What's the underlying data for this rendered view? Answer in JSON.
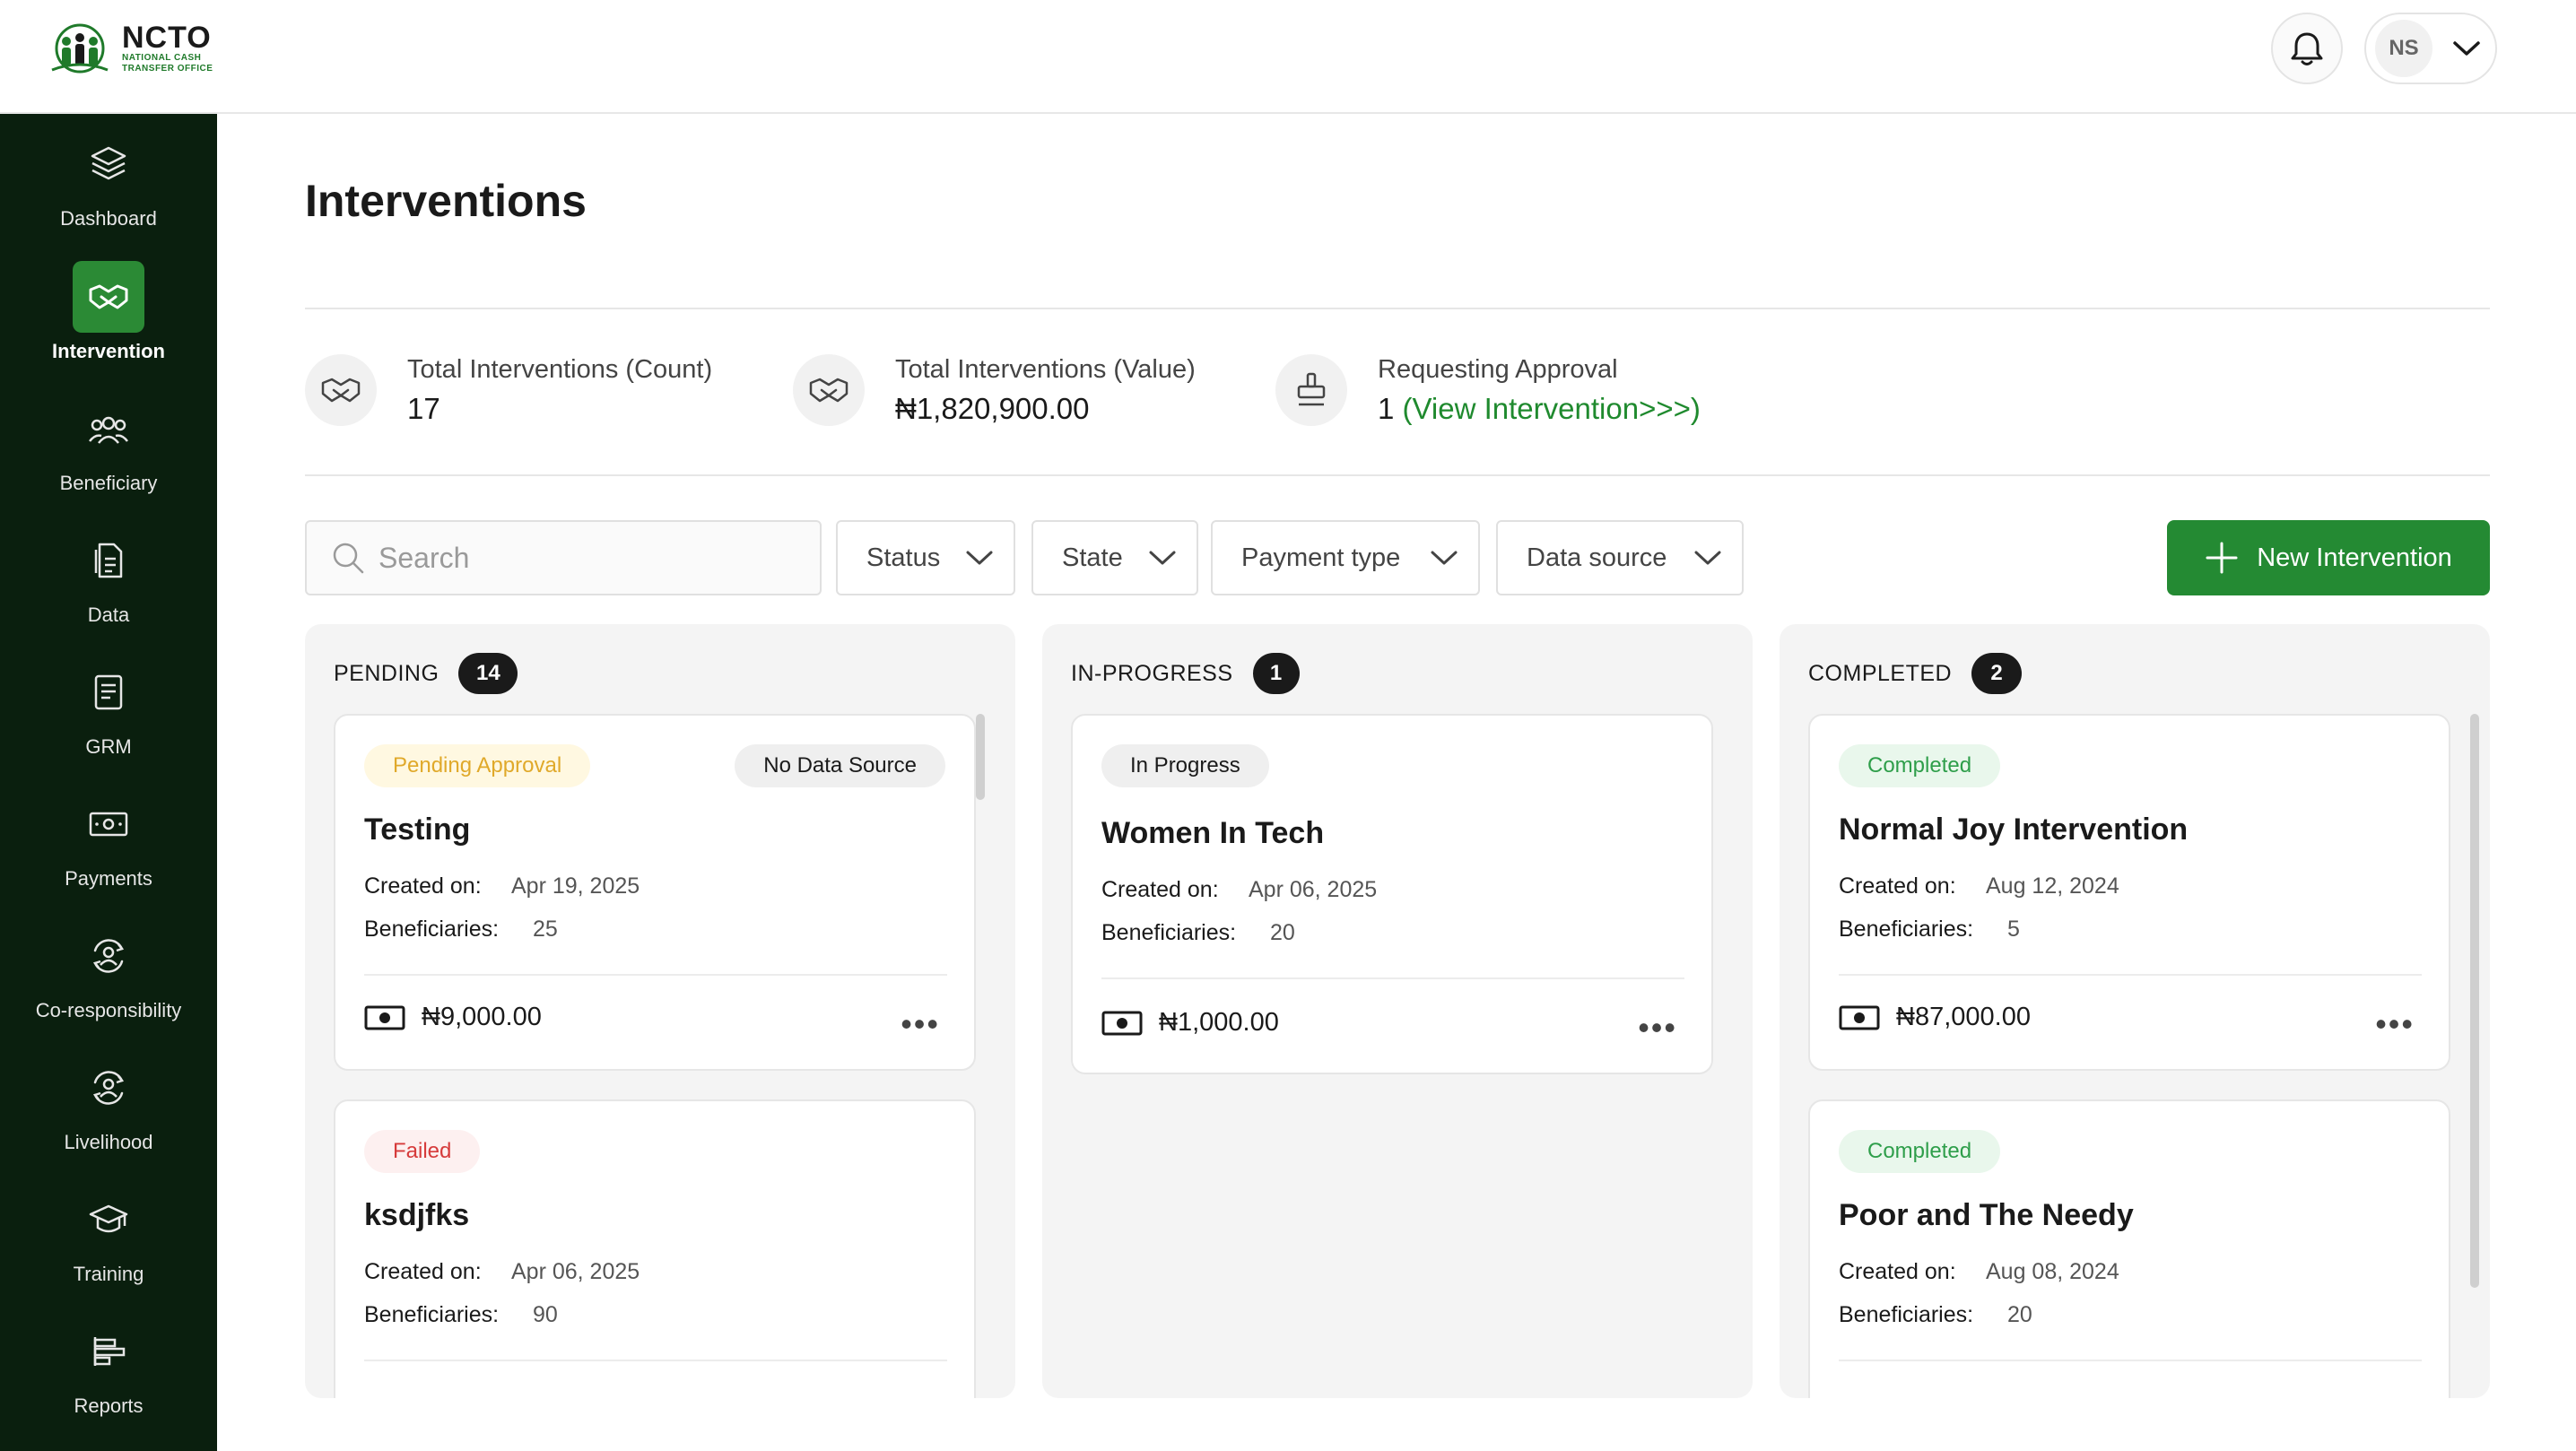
{
  "app": {
    "logo_title": "NCTO",
    "logo_sub_1": "NATIONAL CASH",
    "logo_sub_2": "TRANSFER OFFICE",
    "user_initials": "NS",
    "accent": "#248a33",
    "sidebar_bg": "#0a1f0e"
  },
  "sidebar": {
    "items": [
      {
        "label": "Dashboard",
        "icon": "layers-icon"
      },
      {
        "label": "Intervention",
        "icon": "handshake-icon",
        "active": true
      },
      {
        "label": "Beneficiary",
        "icon": "users-icon"
      },
      {
        "label": "Data",
        "icon": "document-icon"
      },
      {
        "label": "GRM",
        "icon": "notes-icon"
      },
      {
        "label": "Payments",
        "icon": "cash-icon"
      },
      {
        "label": "Co-responsibility",
        "icon": "user-cycle-icon"
      },
      {
        "label": "Livelihood",
        "icon": "user-cycle-icon"
      },
      {
        "label": "Training",
        "icon": "graduation-cap-icon"
      },
      {
        "label": "Reports",
        "icon": "bar-chart-icon"
      }
    ]
  },
  "page": {
    "title": "Interventions"
  },
  "stats": {
    "count_label": "Total Interventions (Count)",
    "count_value": "17",
    "value_label": "Total Interventions (Value)",
    "value_value": "₦1,820,900.00",
    "approval_label": "Requesting Approval",
    "approval_value": "1",
    "approval_link": "(View Intervention>>>)"
  },
  "filters": {
    "search_placeholder": "Search",
    "status": "Status",
    "state": "State",
    "payment_type": "Payment type",
    "data_source": "Data source",
    "new_button": "New Intervention"
  },
  "columns": {
    "pending": {
      "title": "PENDING",
      "count": "14",
      "cards": [
        {
          "status": "Pending Approval",
          "source": "No Data Source",
          "title": "Testing",
          "created_label": "Created on:",
          "created": "Apr 19, 2025",
          "beneficiaries_label": "Beneficiaries:",
          "beneficiaries": "25",
          "amount": "₦9,000.00"
        },
        {
          "status": "Failed",
          "title": "ksdjfks",
          "created_label": "Created on:",
          "created": "Apr 06, 2025",
          "beneficiaries_label": "Beneficiaries:",
          "beneficiaries": "90"
        }
      ]
    },
    "in_progress": {
      "title": "IN-PROGRESS",
      "count": "1",
      "cards": [
        {
          "status": "In Progress",
          "title": "Women In Tech",
          "created_label": "Created on:",
          "created": "Apr 06, 2025",
          "beneficiaries_label": "Beneficiaries:",
          "beneficiaries": "20",
          "amount": "₦1,000.00"
        }
      ]
    },
    "completed": {
      "title": "COMPLETED",
      "count": "2",
      "cards": [
        {
          "status": "Completed",
          "title": "Normal Joy Intervention",
          "created_label": "Created on:",
          "created": "Aug 12, 2024",
          "beneficiaries_label": "Beneficiaries:",
          "beneficiaries": "5",
          "amount": "₦87,000.00"
        },
        {
          "status": "Completed",
          "title": "Poor and The Needy",
          "created_label": "Created on:",
          "created": "Aug 08, 2024",
          "beneficiaries_label": "Beneficiaries:",
          "beneficiaries": "20"
        }
      ]
    }
  }
}
